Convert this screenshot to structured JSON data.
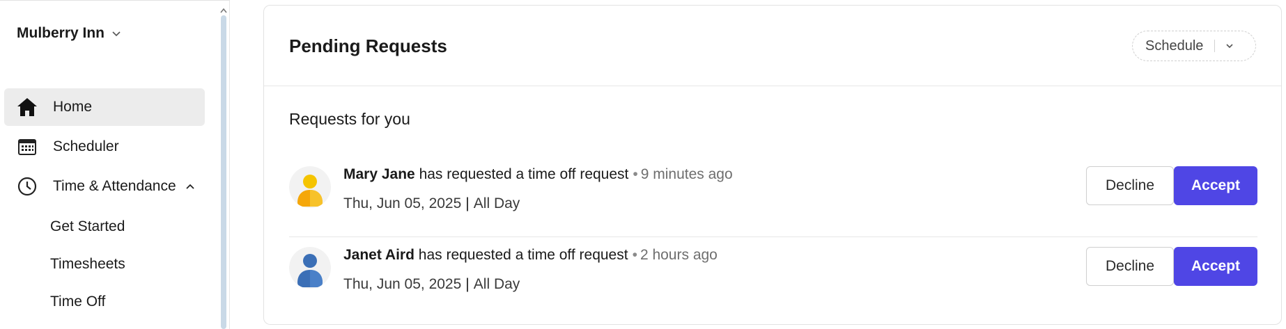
{
  "sidebar": {
    "org_name": "Mulberry Inn",
    "nav": [
      {
        "label": "Home",
        "icon": "home-icon",
        "active": true
      },
      {
        "label": "Scheduler",
        "icon": "calendar-icon"
      },
      {
        "label": "Time & Attendance",
        "icon": "clock-icon",
        "expanded": true
      }
    ],
    "sub_items": [
      {
        "label": "Get Started"
      },
      {
        "label": "Timesheets"
      },
      {
        "label": "Time Off"
      }
    ]
  },
  "panel": {
    "title": "Pending Requests",
    "filter_label": "Schedule",
    "section_title": "Requests for you",
    "requests": [
      {
        "name": "Mary Jane",
        "action": "has requested a time off request",
        "separator": "•",
        "time_ago": "9 minutes ago",
        "date": "Thu, Jun 05, 2025",
        "divider": "|",
        "duration": "All Day",
        "avatar_color": "#f5a70a",
        "decline_label": "Decline",
        "accept_label": "Accept"
      },
      {
        "name": "Janet Aird",
        "action": "has requested a time off request",
        "separator": "•",
        "time_ago": "2 hours ago",
        "date": "Thu, Jun 05, 2025",
        "divider": "|",
        "duration": "All Day",
        "avatar_color": "#3b6fb6",
        "decline_label": "Decline",
        "accept_label": "Accept"
      }
    ]
  },
  "colors": {
    "accent": "#4f46e5",
    "active_nav_bg": "#ececec",
    "scrollbar": "#c9d9e7"
  }
}
